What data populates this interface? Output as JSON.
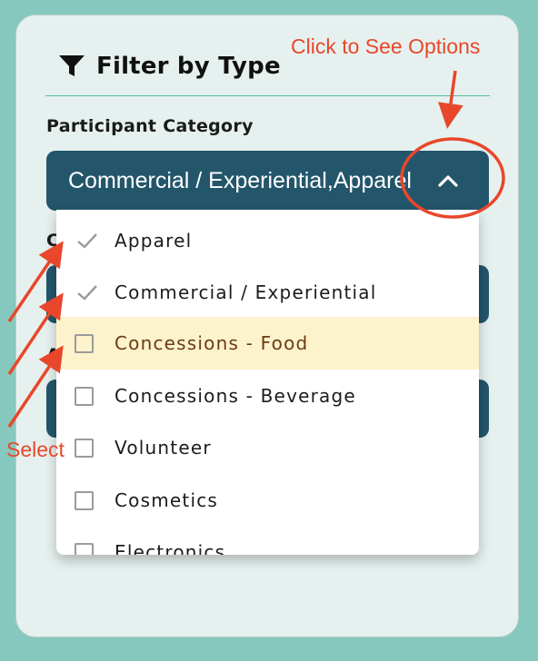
{
  "panel": {
    "title": "Filter by Type",
    "title_icon": "filter-icon"
  },
  "participant_category": {
    "label": "Participant Category",
    "selected_value": "Commercial / Experiential,Apparel",
    "toggle_icon": "chevron-up-icon",
    "expanded": true,
    "options": [
      {
        "label": "Apparel",
        "checked": true
      },
      {
        "label": "Commercial / Experiential",
        "checked": true
      },
      {
        "label": "Concessions - Food",
        "checked": false,
        "highlighted": true
      },
      {
        "label": "Concessions - Beverage",
        "checked": false
      },
      {
        "label": "Volunteer",
        "checked": false
      },
      {
        "label": "Cosmetics",
        "checked": false
      },
      {
        "label": "Electronics",
        "checked": false
      }
    ]
  },
  "hidden_label_1": "C",
  "hidden_label_2": "A",
  "annotations": {
    "options_hint": "Click to See Options",
    "select_hint": "Select"
  },
  "colors": {
    "background": "#86c8bd",
    "panel": "#e6f1ef",
    "select_bar": "#23566b",
    "highlight_row": "#fcf3cd",
    "annotation": "#e8472b"
  }
}
